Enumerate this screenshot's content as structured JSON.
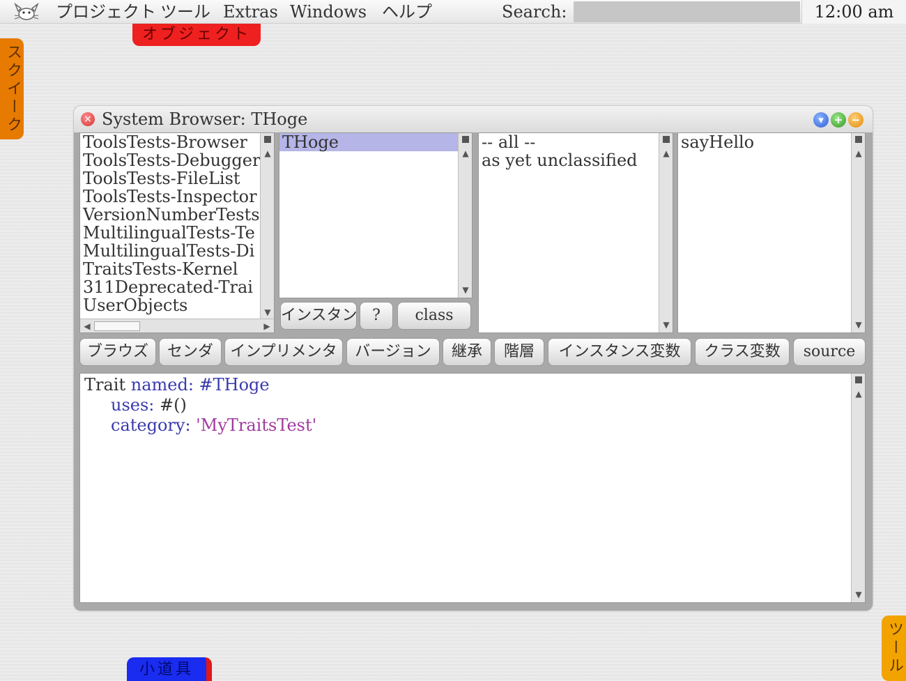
{
  "menubar": {
    "items": [
      "プロジェクト",
      "ツール",
      "Extras",
      "Windows",
      "ヘルプ"
    ],
    "search_label": "Search:",
    "search_value": "",
    "clock": "12:00 am"
  },
  "flaps": {
    "objects": "オブジェクト",
    "squeak": "スクイーク",
    "tools": "ツール",
    "supplies": "小道具"
  },
  "window": {
    "title": "System Browser: THoge",
    "packages": [
      "ToolsTests-Browser",
      "ToolsTests-Debugger",
      "ToolsTests-FileList",
      "ToolsTests-Inspector",
      "VersionNumberTests",
      "MultilingualTests-Te",
      "MultilingualTests-Di",
      "TraitsTests-Kernel",
      "311Deprecated-Trai",
      "UserObjects"
    ],
    "classes": [
      "THoge"
    ],
    "selected_class": "THoge",
    "instance_button": "インスタンス",
    "help_button": "?",
    "class_button": "class",
    "categories": [
      "-- all --",
      "as yet unclassified"
    ],
    "methods": [
      "sayHello"
    ],
    "toolbar": [
      "ブラウズ",
      "センダ",
      "インプリメンタ",
      "バージョン",
      "継承",
      "階層",
      "インスタンス変数",
      "クラス変数",
      "source"
    ],
    "code": {
      "line1_a": "Trait ",
      "line1_b": "named: #THoge",
      "line2_a": "uses: ",
      "line2_b": "#()",
      "line3_a": "category: ",
      "line3_b": "'MyTraitsTest'"
    }
  }
}
